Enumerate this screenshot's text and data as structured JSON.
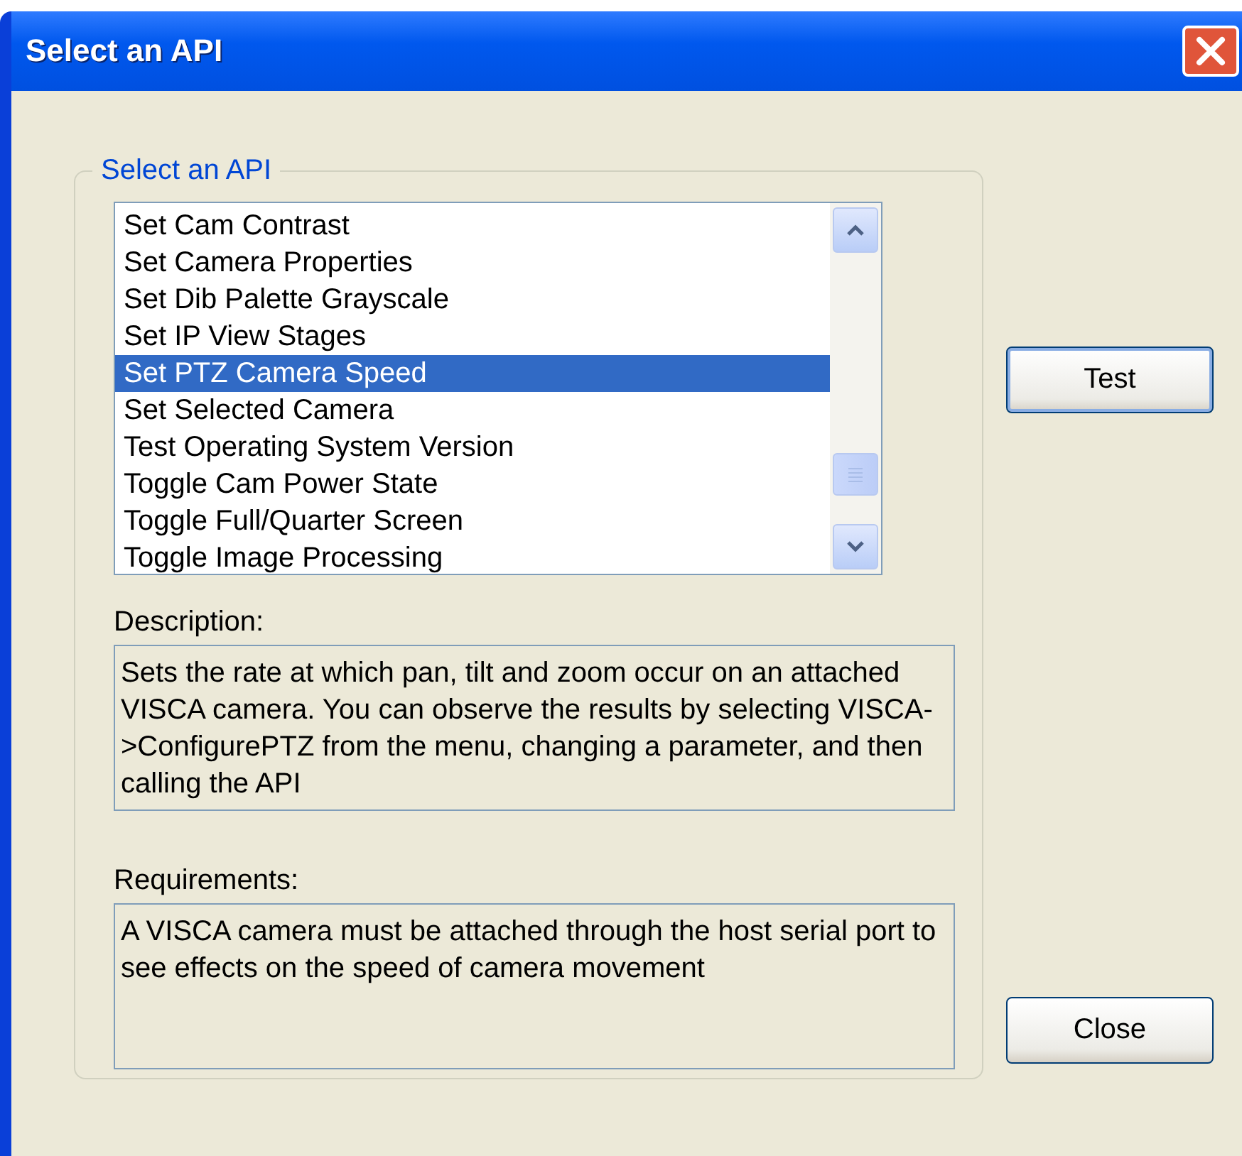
{
  "window": {
    "title": "Select an API"
  },
  "group": {
    "label": "Select an API"
  },
  "api_list": {
    "items": [
      {
        "label": "Set Cam Contrast",
        "selected": false
      },
      {
        "label": "Set Camera Properties",
        "selected": false
      },
      {
        "label": "Set Dib Palette Grayscale",
        "selected": false
      },
      {
        "label": "Set IP View Stages",
        "selected": false
      },
      {
        "label": "Set PTZ Camera Speed",
        "selected": true
      },
      {
        "label": "Set Selected Camera",
        "selected": false
      },
      {
        "label": "Test Operating System Version",
        "selected": false
      },
      {
        "label": "Toggle Cam Power State",
        "selected": false
      },
      {
        "label": "Toggle Full/Quarter Screen",
        "selected": false
      },
      {
        "label": "Toggle Image Processing",
        "selected": false
      }
    ]
  },
  "description": {
    "label": "Description:",
    "text": "Sets the rate at which pan, tilt and zoom occur on an attached VISCA camera. You can observe the results by selecting VISCA->ConfigurePTZ from the menu, changing a parameter, and then calling the API"
  },
  "requirements": {
    "label": "Requirements:",
    "text": "A VISCA camera must be attached through the host serial port to see effects on the speed of camera movement"
  },
  "buttons": [
    {
      "label": "Test",
      "kind": "default"
    },
    {
      "label": "Close",
      "kind": "normal"
    }
  ]
}
